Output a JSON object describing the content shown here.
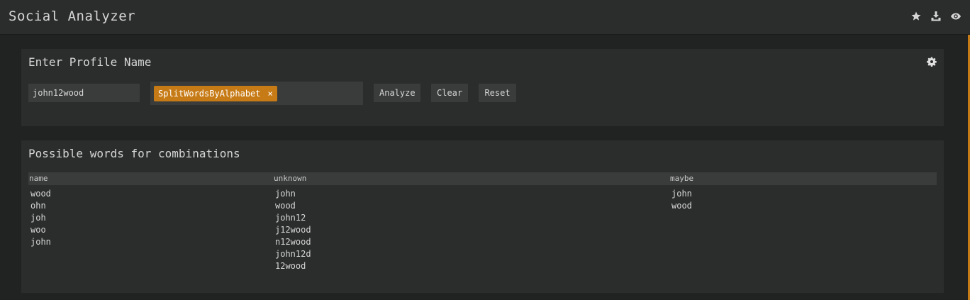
{
  "header": {
    "title": "Social Analyzer",
    "icons": [
      "star-icon",
      "download-icon",
      "eye-icon"
    ]
  },
  "profile_panel": {
    "title": "Enter Profile Name",
    "input_value": "john12wood",
    "tag_label": "SplitWordsByAlphabet",
    "tag_remove": "×",
    "buttons": {
      "analyze": "Analyze",
      "clear": "Clear",
      "reset": "Reset"
    }
  },
  "results_panel": {
    "title": "Possible words for combinations",
    "columns": {
      "name": "name",
      "unknown": "unknown",
      "maybe": "maybe"
    },
    "name": [
      "wood",
      "ohn",
      "joh",
      "woo",
      "john"
    ],
    "unknown": [
      "john",
      "wood",
      "john12",
      "j12wood",
      "n12wood",
      "john12d",
      "12wood"
    ],
    "maybe": [
      "john",
      "wood"
    ]
  },
  "colors": {
    "accent": "#c77b16",
    "background": "#212322",
    "panel": "#2b2d2c"
  }
}
